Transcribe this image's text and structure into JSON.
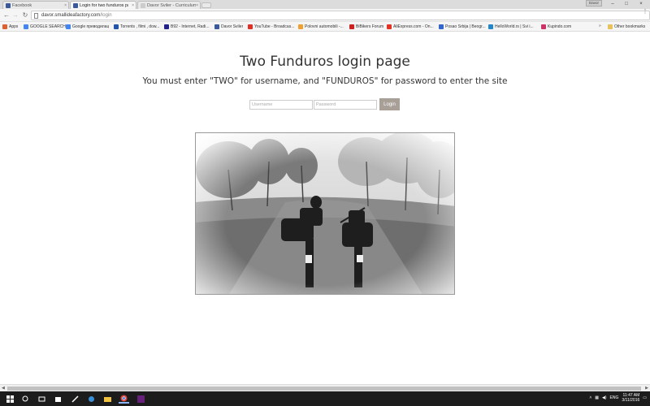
{
  "browser": {
    "tabs": [
      {
        "label": "Facebook",
        "color": "#3b5998"
      },
      {
        "label": "Login for two funduros pa",
        "color": "#3b5998",
        "active": true
      },
      {
        "label": "Davor Sviler - Curriculum",
        "color": "#cccccc"
      }
    ],
    "tab_close": "×",
    "user_badge": "Davor",
    "window_controls": {
      "minimize": "–",
      "maximize": "□",
      "close": "×"
    },
    "nav": {
      "back": "←",
      "forward": "→",
      "reload": "↻"
    },
    "url_host": "davor.smallideafactory.com",
    "url_path": "/login",
    "star": "☆",
    "menu": "⋮"
  },
  "bookmarks": {
    "items": [
      {
        "label": "Apps",
        "color": "#e06030"
      },
      {
        "label": "GOOGLE SEARCH",
        "color": "#4285f4"
      },
      {
        "label": "Google преводилац",
        "color": "#4285f4"
      },
      {
        "label": "Torrents , filmi , dow...",
        "color": "#2255aa"
      },
      {
        "label": "B92 - Internet, Radi...",
        "color": "#222288"
      },
      {
        "label": "Davor Sviler",
        "color": "#3b5998"
      },
      {
        "label": "YouTube - Broadcas...",
        "color": "#e52d27"
      },
      {
        "label": "Polovni automobili -...",
        "color": "#f0a030"
      },
      {
        "label": "BiBikers Forum",
        "color": "#cc2222"
      },
      {
        "label": "AliExpress.com - On...",
        "color": "#e43225"
      },
      {
        "label": "Posao Srbija | Beogr...",
        "color": "#3366cc"
      },
      {
        "label": "HelloWorld.rs | Svi i...",
        "color": "#2288cc"
      },
      {
        "label": "Kupindo.com",
        "color": "#cc3366"
      }
    ],
    "more": "»",
    "other": "Other bookmarks"
  },
  "page": {
    "title": "Two Funduros login page",
    "subtitle": "You must enter \"TWO\" for username, and \"FUNDUROS\" for password to enter the site",
    "username_placeholder": "Username",
    "password_placeholder": "Password",
    "login_label": "Login",
    "button_color": "#a89f96"
  },
  "taskbar": {
    "language": "ENG",
    "time": "11:47 AM",
    "date": "3/11/2016"
  }
}
